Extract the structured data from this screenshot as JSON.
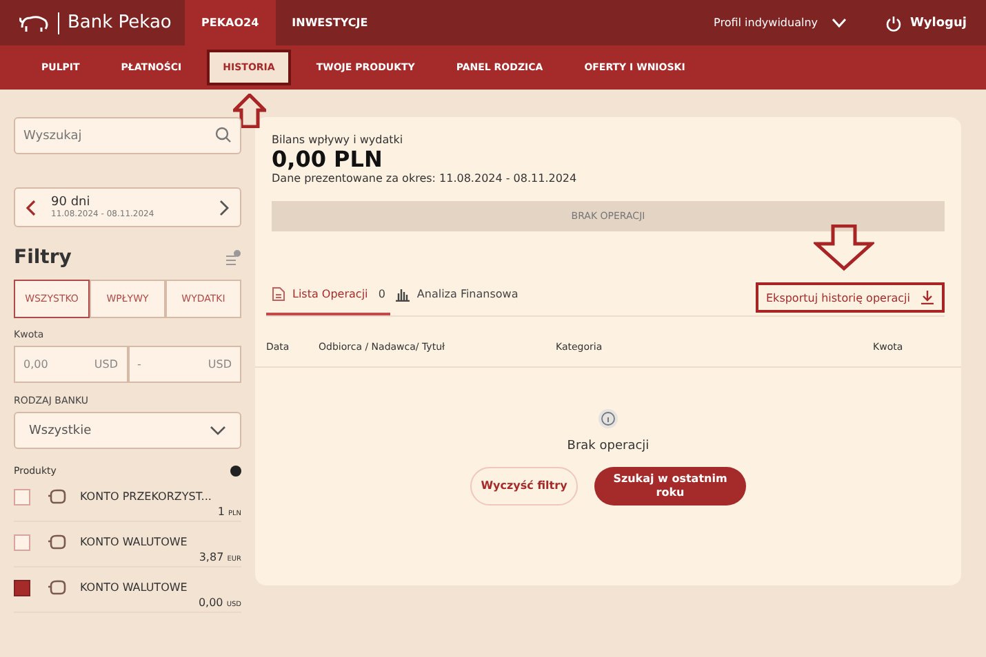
{
  "header": {
    "brand": "Bank Pekao",
    "top_tabs": [
      {
        "label": "PEKAO24",
        "selected": true
      },
      {
        "label": "INWESTYCJE",
        "selected": false
      }
    ],
    "profile": "Profil indywidualny",
    "logout": "Wyloguj"
  },
  "nav": [
    {
      "label": "PULPIT",
      "selected": false,
      "annotated": false
    },
    {
      "label": "PŁATNOŚCI",
      "selected": false,
      "annotated": false
    },
    {
      "label": "HISTORIA",
      "selected": true,
      "annotated": true
    },
    {
      "label": "TWOJE PRODUKTY",
      "selected": false,
      "annotated": false
    },
    {
      "label": "PANEL RODZICA",
      "selected": false,
      "annotated": false
    },
    {
      "label": "OFERTY I WNIOSKI",
      "selected": false,
      "annotated": false
    }
  ],
  "sidebar": {
    "search": {
      "placeholder": "Wyszukaj"
    },
    "period": {
      "label": "90 dni",
      "range": "11.08.2024 - 08.11.2024"
    },
    "filters_title": "Filtry",
    "type_filter": [
      {
        "label": "WSZYSTKO",
        "selected": true
      },
      {
        "label": "WPŁYWY",
        "selected": false
      },
      {
        "label": "WYDATKI",
        "selected": false
      }
    ],
    "amount_label": "Kwota",
    "amount_from": {
      "placeholder": "0,00",
      "currency": "USD"
    },
    "amount_to": {
      "placeholder": "-",
      "currency": "USD"
    },
    "bank_type_label": "RODZAJ BANKU",
    "bank_type": "Wszystkie",
    "products_label": "Produkty",
    "products": [
      {
        "name": "KONTO PRZEKORZYST...",
        "amount": "1",
        "currency": "PLN",
        "checked": false
      },
      {
        "name": "KONTO WALUTOWE",
        "amount": "3,87",
        "currency": "EUR",
        "checked": false
      },
      {
        "name": "KONTO WALUTOWE",
        "amount": "0,00",
        "currency": "USD",
        "checked": true
      }
    ]
  },
  "main": {
    "balance_label": "Bilans wpływy i wydatki",
    "balance": "0,00 PLN",
    "period_text": "Dane prezentowane za okres: 11.08.2024 - 08.11.2024",
    "bar_text": "BRAK OPERACJI",
    "tabs": [
      {
        "label": "Lista Operacji",
        "count": "0",
        "selected": true,
        "kind": "list"
      },
      {
        "label": "Analiza Finansowa",
        "selected": false,
        "kind": "chart"
      }
    ],
    "export": {
      "label": "Eksportuj historię operacji",
      "annotated": true
    },
    "columns": [
      "Data",
      "Odbiorca / Nadawca/ Tytuł",
      "Kategoria",
      "Kwota"
    ],
    "empty_text": "Brak operacji",
    "buttons": [
      {
        "label": "Wyczyść filtry",
        "kind": "secondary"
      },
      {
        "label": "Szukaj w ostatnim roku",
        "kind": "primary"
      }
    ]
  }
}
